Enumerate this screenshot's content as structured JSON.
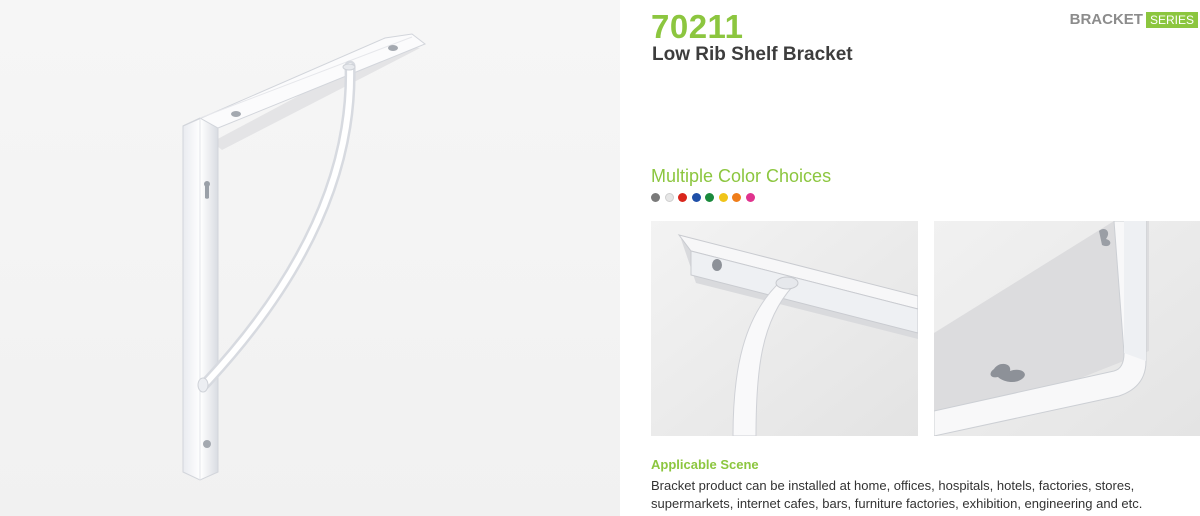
{
  "product": {
    "model": "70211",
    "name": "Low Rib Shelf Bracket"
  },
  "series_badge": {
    "word": "BRACKET",
    "tag": "SERIES"
  },
  "colors": {
    "heading": "Multiple Color Choices",
    "swatches": [
      "#7a7a7a",
      "#e6e6e6",
      "#d9261c",
      "#1f4fa8",
      "#1a8a3c",
      "#f0c419",
      "#ef7d1a",
      "#e0338e"
    ]
  },
  "scene": {
    "heading": "Applicable Scene",
    "text": "Bracket product can be installed at home, offices, hospitals, hotels, factories, stores, supermarkets, internet cafes, bars, furniture factories, exhibition, engineering and etc."
  }
}
